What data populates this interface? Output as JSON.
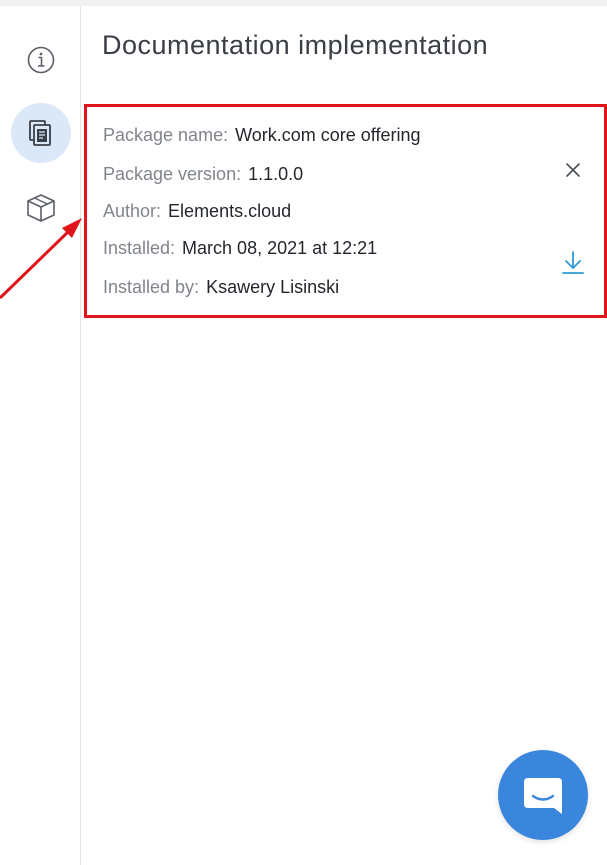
{
  "panel": {
    "title": "Documentation implementation"
  },
  "rail": {
    "items": [
      {
        "name": "info",
        "icon": "info-icon",
        "active": false
      },
      {
        "name": "documentation",
        "icon": "documents-icon",
        "active": true
      },
      {
        "name": "package",
        "icon": "package-box-icon",
        "active": false
      }
    ]
  },
  "package": {
    "fields": [
      {
        "label": "Package name:",
        "value": "Work.com core offering"
      },
      {
        "label": "Package version:",
        "value": "1.1.0.0"
      },
      {
        "label": "Author:",
        "value": "Elements.cloud"
      },
      {
        "label": "Installed:",
        "value": "March 08, 2021 at 12:21"
      },
      {
        "label": "Installed by:",
        "value": "Ksawery Lisinski"
      }
    ]
  },
  "actions": {
    "close_icon": "close-icon",
    "download_icon": "download-icon"
  },
  "chat": {
    "icon": "chat-icon"
  },
  "colors": {
    "accent": "#3a86dc",
    "highlight_border": "#e0151c",
    "active_rail": "#dbe8f8",
    "download": "#2f9bd6"
  }
}
